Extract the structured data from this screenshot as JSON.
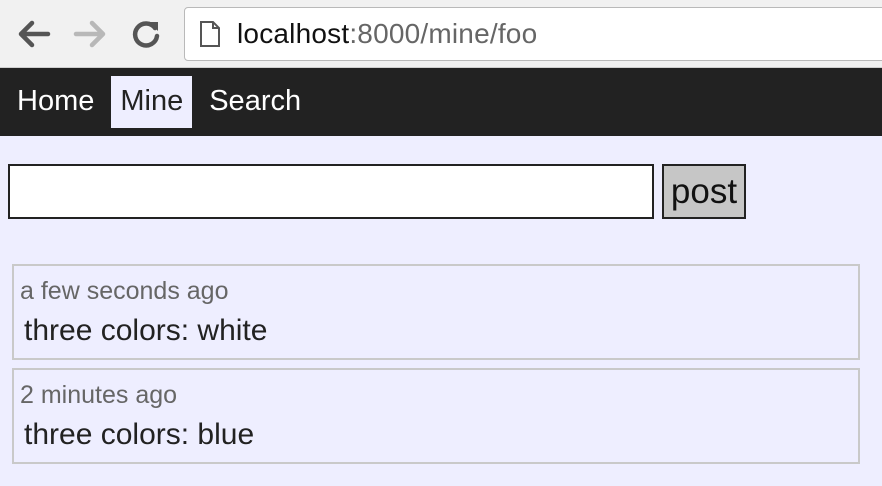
{
  "browser": {
    "url_host": "localhost",
    "url_rest": ":8000/mine/foo"
  },
  "nav": {
    "items": [
      {
        "label": "Home",
        "active": false
      },
      {
        "label": "Mine",
        "active": true
      },
      {
        "label": "Search",
        "active": false
      }
    ]
  },
  "form": {
    "input_value": "",
    "button_label": "post"
  },
  "posts": [
    {
      "time": "a few seconds ago",
      "text": "three colors: white"
    },
    {
      "time": "2 minutes ago",
      "text": "three colors: blue"
    }
  ],
  "colors": {
    "page_bg": "#eeeeff",
    "nav_bg": "#222222",
    "button_bg": "#c6c6c6"
  }
}
